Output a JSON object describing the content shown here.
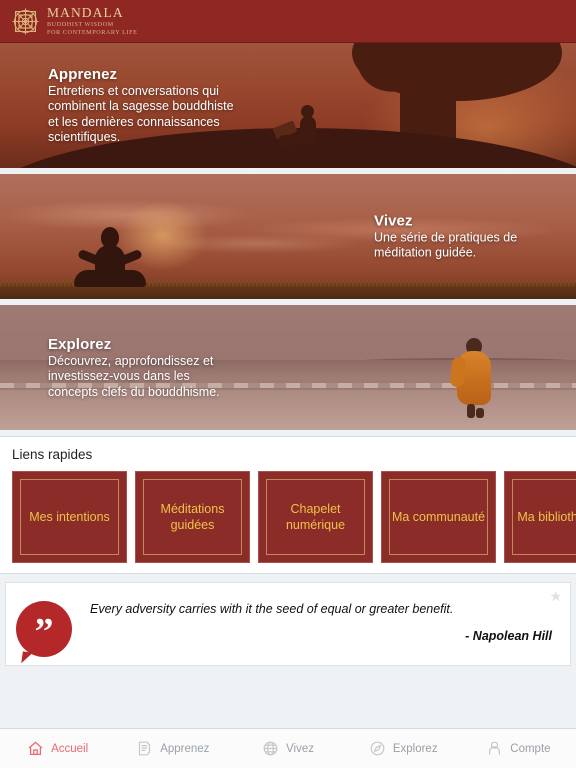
{
  "header": {
    "logo_icon": "mandala-icon",
    "brand": "MANDALA",
    "tagline_line1": "BUDDHIST WISDOM",
    "tagline_line2": "FOR CONTEMPORARY LIFE",
    "background_color": "#8f2723",
    "brand_color": "#e8cf9e"
  },
  "banners": [
    {
      "title": "Apprenez",
      "description": "Entretiens et conversations qui combinent la sagesse bouddhiste et les dernières connaissances scientifiques.",
      "align": "left",
      "art": "person-reading-under-tree-at-sunset"
    },
    {
      "title": "Vivez",
      "description": "Une série de pratiques de méditation guidée.",
      "align": "right",
      "art": "meditating-silhouette-at-sunset"
    },
    {
      "title": "Explorez",
      "description": "Découvrez, approfondissez et investissez-vous dans les concepts clefs du bouddhisme.",
      "align": "left",
      "art": "monk-walking-on-beach"
    }
  ],
  "quick_links": {
    "title": "Liens rapides",
    "tile_bg_color": "#8b2c28",
    "tile_text_color": "#f0c24a",
    "items": [
      {
        "label": "Mes intentions"
      },
      {
        "label": "Méditations guidées"
      },
      {
        "label": "Chapelet numérique"
      },
      {
        "label": "Ma communauté"
      },
      {
        "label": "Ma bibliothèque"
      }
    ]
  },
  "quote": {
    "icon": "quote-bubble-icon",
    "marks": "”",
    "text": "Every adversity carries with it the seed of equal or greater benefit.",
    "author": "- Napolean Hill",
    "favorite_icon": "star-icon",
    "favorite_glyph": "★",
    "bubble_color": "#b5282a"
  },
  "tabbar": {
    "active_color": "#ea6a72",
    "inactive_color": "#9aa0a6",
    "tabs": [
      {
        "label": "Accueil",
        "icon": "home-icon",
        "active": true
      },
      {
        "label": "Apprenez",
        "icon": "document-icon",
        "active": false
      },
      {
        "label": "Vivez",
        "icon": "globe-icon",
        "active": false
      },
      {
        "label": "Explorez",
        "icon": "compass-icon",
        "active": false
      },
      {
        "label": "Compte",
        "icon": "person-icon",
        "active": false
      }
    ]
  }
}
